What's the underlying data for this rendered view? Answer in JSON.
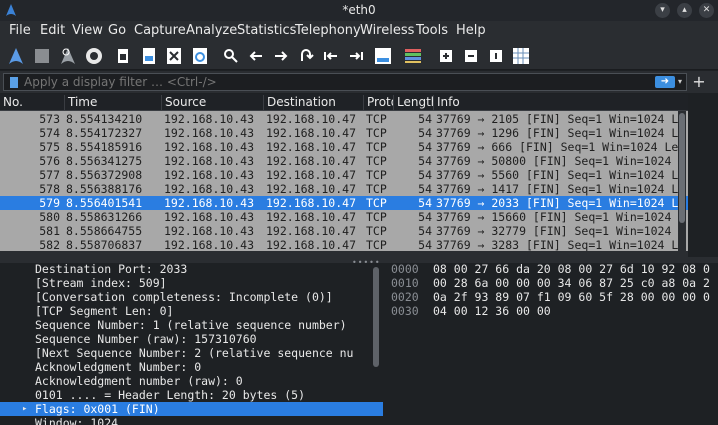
{
  "window": {
    "title": "*eth0",
    "controls": [
      "minimize-icon",
      "maximize-icon",
      "close-icon"
    ]
  },
  "menu": [
    {
      "label": "File",
      "name": "file"
    },
    {
      "label": "Edit",
      "name": "edit"
    },
    {
      "label": "View",
      "name": "view"
    },
    {
      "label": "Go",
      "name": "go"
    },
    {
      "label": "Capture",
      "name": "capture"
    },
    {
      "label": "Analyze",
      "name": "analyze"
    },
    {
      "label": "Statistics",
      "name": "statistics"
    },
    {
      "label": "Telephony",
      "name": "telephony"
    },
    {
      "label": "Wireless",
      "name": "wireless"
    },
    {
      "label": "Tools",
      "name": "tools"
    },
    {
      "label": "Help",
      "name": "help"
    }
  ],
  "toolbar": [
    "start-capture-icon",
    "stop-capture-icon",
    "restart-capture-icon",
    "capture-options-icon",
    "open-file-icon",
    "save-file-icon",
    "close-file-icon",
    "reload-icon",
    "find-packet-icon",
    "go-back-icon",
    "go-forward-icon",
    "go-to-packet-icon",
    "first-packet-icon",
    "last-packet-icon",
    "autoscroll-icon",
    "colorize-icon",
    "zoom-in-icon",
    "zoom-out-icon",
    "normal-size-icon",
    "resize-columns-icon"
  ],
  "filter": {
    "placeholder": "Apply a display filter … <Ctrl-/>",
    "apply_icon": "arrow-right-icon",
    "dropdown_icon": "chevron-down-icon",
    "add_label": "+"
  },
  "packet_list": {
    "columns": [
      "No.",
      "Time",
      "Source",
      "Destination",
      "Proto",
      "Length",
      "Info"
    ],
    "selected_no": "579",
    "rows": [
      {
        "no": "573",
        "time": "8.554134210",
        "src": "192.168.10.43",
        "dst": "192.168.10.47",
        "proto": "TCP",
        "len": "54",
        "info": "37769 → 2105 [FIN] Seq=1 Win=1024 L"
      },
      {
        "no": "574",
        "time": "8.554172327",
        "src": "192.168.10.43",
        "dst": "192.168.10.47",
        "proto": "TCP",
        "len": "54",
        "info": "37769 → 1296 [FIN] Seq=1 Win=1024 L"
      },
      {
        "no": "575",
        "time": "8.554185916",
        "src": "192.168.10.43",
        "dst": "192.168.10.47",
        "proto": "TCP",
        "len": "54",
        "info": "37769 → 666 [FIN] Seq=1 Win=1024 Le"
      },
      {
        "no": "576",
        "time": "8.556341275",
        "src": "192.168.10.43",
        "dst": "192.168.10.47",
        "proto": "TCP",
        "len": "54",
        "info": "37769 → 50800 [FIN] Seq=1 Win=1024"
      },
      {
        "no": "577",
        "time": "8.556372908",
        "src": "192.168.10.43",
        "dst": "192.168.10.47",
        "proto": "TCP",
        "len": "54",
        "info": "37769 → 5560 [FIN] Seq=1 Win=1024 L"
      },
      {
        "no": "578",
        "time": "8.556388176",
        "src": "192.168.10.43",
        "dst": "192.168.10.47",
        "proto": "TCP",
        "len": "54",
        "info": "37769 → 1417 [FIN] Seq=1 Win=1024 L"
      },
      {
        "no": "579",
        "time": "8.556401541",
        "src": "192.168.10.43",
        "dst": "192.168.10.47",
        "proto": "TCP",
        "len": "54",
        "info": "37769 → 2033 [FIN] Seq=1 Win=1024 L"
      },
      {
        "no": "580",
        "time": "8.558631266",
        "src": "192.168.10.43",
        "dst": "192.168.10.47",
        "proto": "TCP",
        "len": "54",
        "info": "37769 → 15660 [FIN] Seq=1 Win=1024"
      },
      {
        "no": "581",
        "time": "8.558664755",
        "src": "192.168.10.43",
        "dst": "192.168.10.47",
        "proto": "TCP",
        "len": "54",
        "info": "37769 → 32779 [FIN] Seq=1 Win=1024"
      },
      {
        "no": "582",
        "time": "8.558706837",
        "src": "192.168.10.43",
        "dst": "192.168.10.47",
        "proto": "TCP",
        "len": "54",
        "info": "37769 → 3283 [FIN] Seq=1 Win=1024 L"
      }
    ]
  },
  "details": [
    {
      "text": "Destination Port: 2033",
      "selected": false,
      "arrow": false
    },
    {
      "text": "[Stream index: 509]",
      "selected": false,
      "arrow": false
    },
    {
      "text": "[Conversation completeness: Incomplete (0)]",
      "selected": false,
      "arrow": false
    },
    {
      "text": "[TCP Segment Len: 0]",
      "selected": false,
      "arrow": false
    },
    {
      "text": "Sequence Number: 1    (relative sequence number)",
      "selected": false,
      "arrow": false
    },
    {
      "text": "Sequence Number (raw): 157310760",
      "selected": false,
      "arrow": false
    },
    {
      "text": "[Next Sequence Number: 2    (relative sequence nu",
      "selected": false,
      "arrow": false
    },
    {
      "text": "Acknowledgment Number: 0",
      "selected": false,
      "arrow": false
    },
    {
      "text": "Acknowledgment number (raw): 0",
      "selected": false,
      "arrow": false
    },
    {
      "text": "0101 .... = Header Length: 20 bytes (5)",
      "selected": false,
      "arrow": false
    },
    {
      "text": "Flags: 0x001 (FIN)",
      "selected": true,
      "arrow": true
    },
    {
      "text": "Window: 1024",
      "selected": false,
      "arrow": false
    }
  ],
  "hex": [
    {
      "offset": "0000",
      "bytes": "08 00 27 66 da 20 08 00  27 6d 10 92 08 0"
    },
    {
      "offset": "0010",
      "bytes": "00 28 6a 00 00 00 34 06  87 25 c0 a8 0a 2"
    },
    {
      "offset": "0020",
      "bytes": "0a 2f 93 89 07 f1 09 60  5f 28 00 00 00 0"
    },
    {
      "offset": "0030",
      "bytes": "04 00 12 36 00 00"
    }
  ],
  "colors": {
    "selection": "#2a7de1",
    "row_gray": "#a8a8a8",
    "background": "#1e2124"
  }
}
